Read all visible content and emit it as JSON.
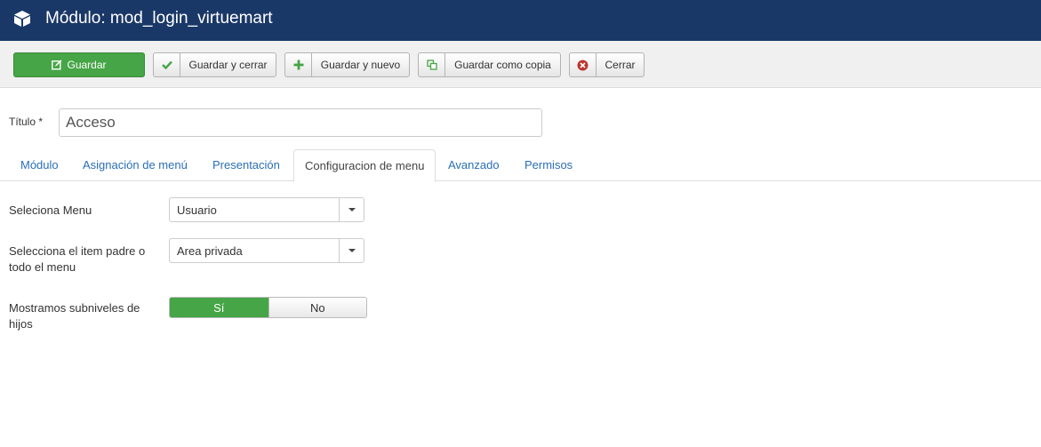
{
  "header": {
    "title": "Módulo: mod_login_virtuemart",
    "icon": "cube-icon"
  },
  "toolbar": {
    "save": "Guardar",
    "save_close": "Guardar y cerrar",
    "save_new": "Guardar y nuevo",
    "save_copy": "Guardar como copia",
    "close": "Cerrar"
  },
  "form": {
    "title_label": "Título *",
    "title_value": "Acceso"
  },
  "tabs": [
    "Módulo",
    "Asignación de menú",
    "Presentación",
    "Configuracion de menu",
    "Avanzado",
    "Permisos"
  ],
  "fields": {
    "menu_label": "Seleciona Menu",
    "menu_value": "Usuario",
    "parent_label": "Selecciona el item padre o todo el menu",
    "parent_value": "Area privada",
    "sublevels_label": "Mostramos subniveles de hijos",
    "yes": "Sí",
    "no": "No"
  },
  "colors": {
    "header": "#1a3867",
    "success": "#46a546",
    "link": "#2a6fb6"
  }
}
